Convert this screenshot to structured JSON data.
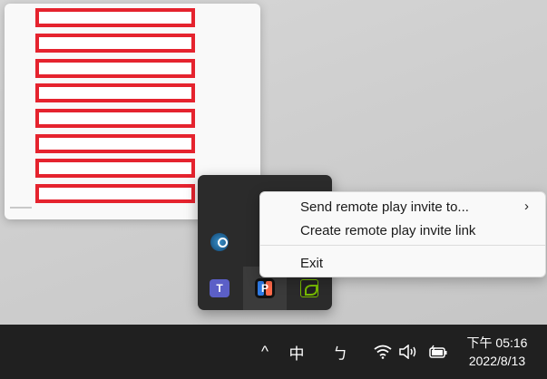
{
  "context_menu": {
    "items": [
      {
        "label": "Send remote play invite to...",
        "has_submenu": true,
        "chevron": "›"
      },
      {
        "label": "Create remote play invite link",
        "has_submenu": false
      },
      {
        "label": "Exit",
        "has_submenu": false
      }
    ]
  },
  "taskbar": {
    "chevron_glyph": "^",
    "ime_mode": "中",
    "ime_secondary": "ㄅ",
    "clock": {
      "time": "下午 05:16",
      "date": "2022/8/13"
    }
  },
  "tray_icons": {
    "teams_letter": "T",
    "parsec_letter": "P"
  },
  "colors": {
    "redaction": "#e5232e",
    "taskbar": "#202020",
    "tray_panel": "#2b2b2b"
  }
}
